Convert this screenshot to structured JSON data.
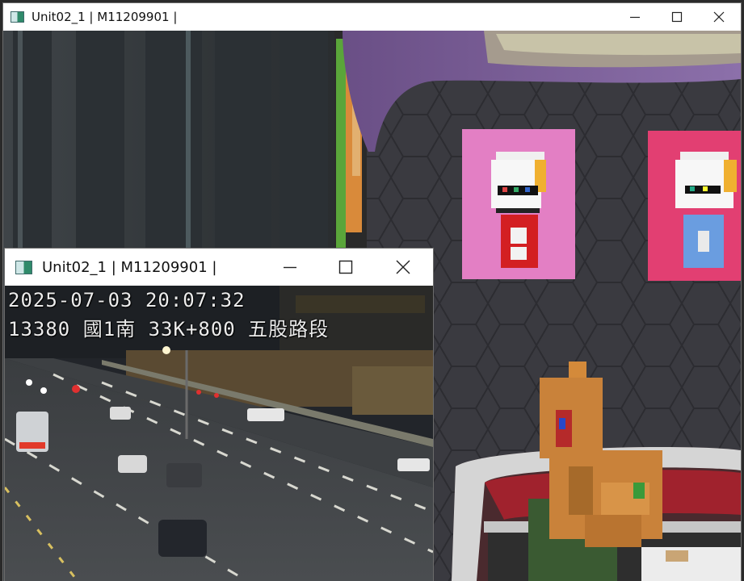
{
  "main_window": {
    "title": "Unit02_1 | M11209901 |",
    "icon": "unity-app-icon",
    "controls": [
      "minimize-icon",
      "maximize-icon",
      "close-icon"
    ]
  },
  "camera_window": {
    "title": "Unit02_1 | M11209901 |",
    "icon": "unity-app-icon",
    "controls": [
      "minimize-icon",
      "maximize-icon",
      "close-icon"
    ],
    "overlay": {
      "timestamp": "2025-07-03 20:07:32",
      "location": "13380 國1南 33K+800 五股路段"
    }
  },
  "colors": {
    "poster_left_bg": "#e37fc4",
    "poster_right_bg": "#e23f72",
    "titlebar_bg": "#ffffff"
  }
}
